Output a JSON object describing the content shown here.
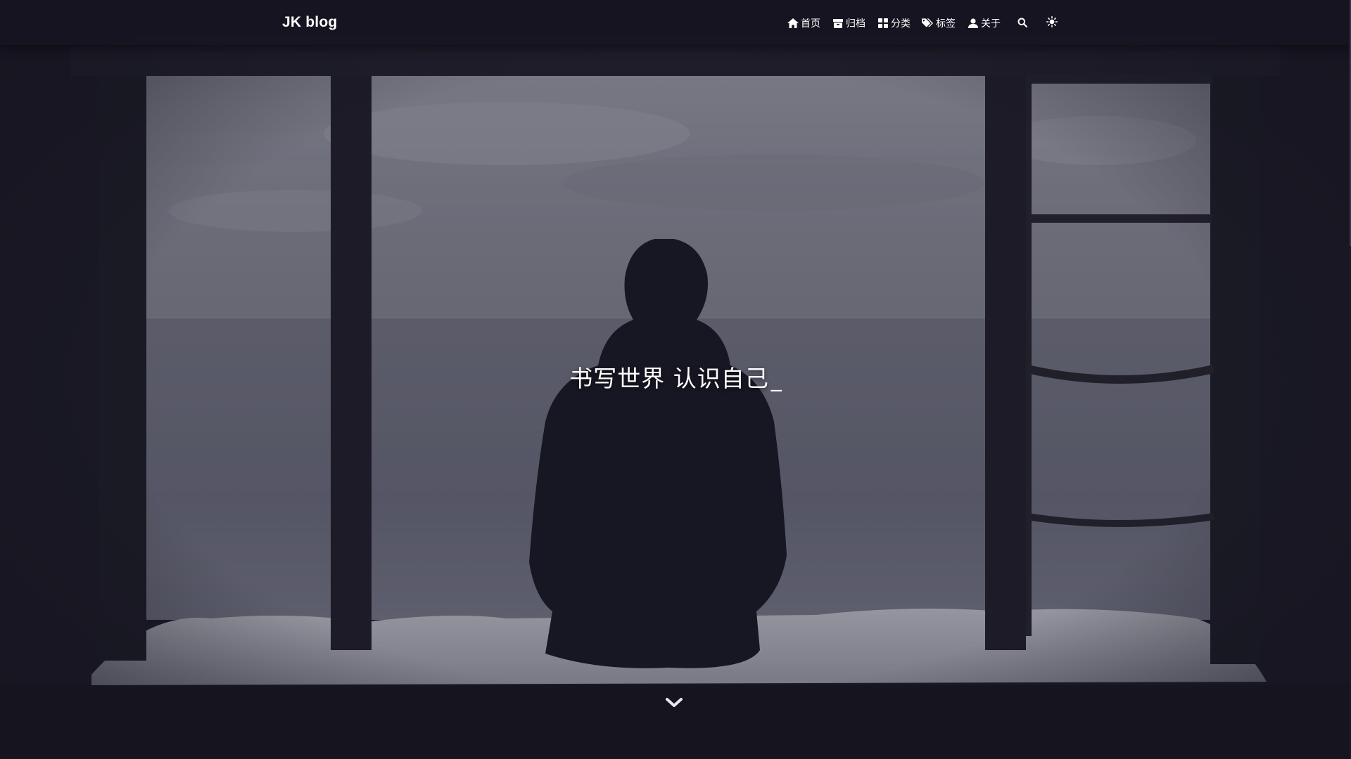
{
  "brand": {
    "title": "JK blog"
  },
  "nav": {
    "items": [
      {
        "label": "首页",
        "icon": "home-icon"
      },
      {
        "label": "归档",
        "icon": "archive-icon"
      },
      {
        "label": "分类",
        "icon": "category-icon"
      },
      {
        "label": "标签",
        "icon": "tags-icon"
      },
      {
        "label": "关于",
        "icon": "user-icon"
      }
    ],
    "search_icon": "search-icon",
    "theme_icon": "theme-toggle-icon"
  },
  "hero": {
    "subtitle": "书写世界 认识自己",
    "cursor": "_",
    "scroll_icon": "chevron-down-icon"
  },
  "colors": {
    "navbar_bg": "#161521",
    "overlay": "#15141f",
    "text": "#ffffff"
  }
}
